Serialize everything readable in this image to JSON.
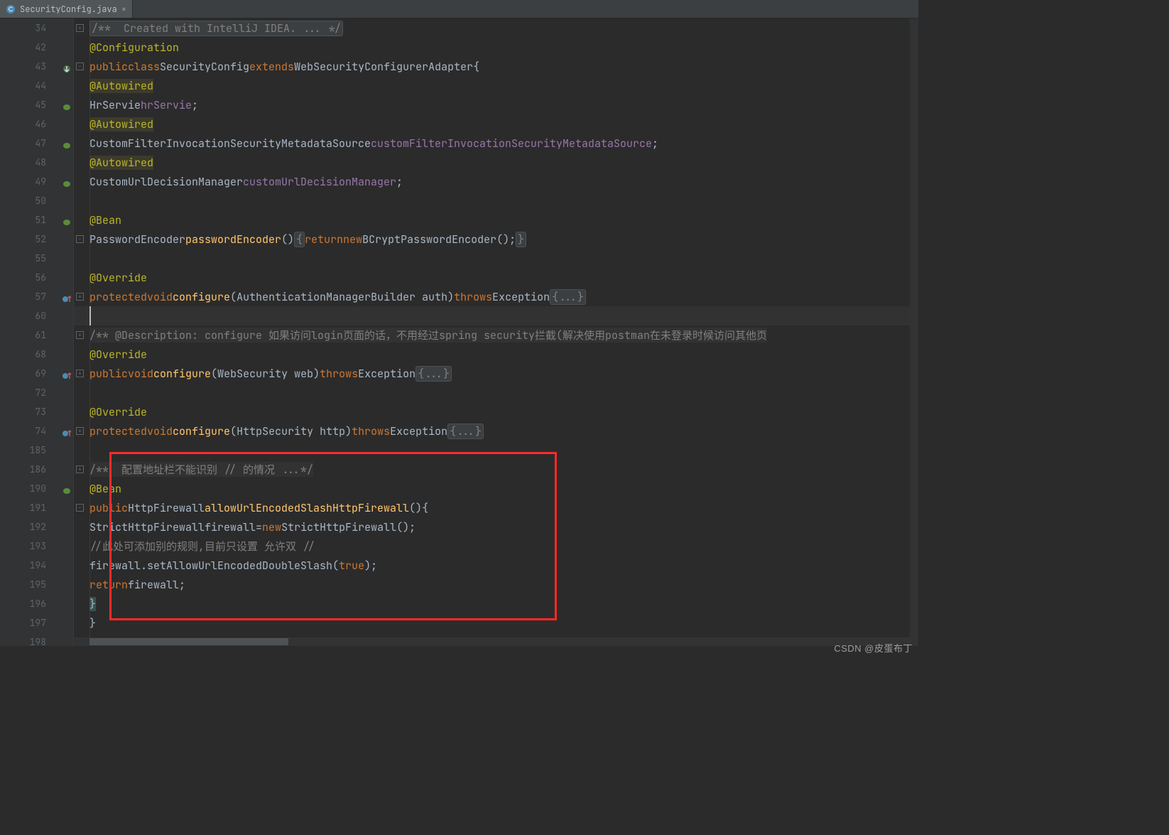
{
  "tab": {
    "filename": "SecurityConfig.java"
  },
  "watermark": "CSDN @皮蛋布丁",
  "gutter": {
    "line_numbers": [
      "34",
      "42",
      "43",
      "44",
      "45",
      "46",
      "47",
      "48",
      "49",
      "50",
      "51",
      "52",
      "55",
      "56",
      "57",
      "60",
      "61",
      "68",
      "69",
      "72",
      "73",
      "74",
      "185",
      "186",
      "190",
      "191",
      "192",
      "193",
      "194",
      "195",
      "196",
      "197",
      "198"
    ]
  },
  "code": {
    "l34": "/**  Created with IntelliJ IDEA. ... */",
    "l42": "@Configuration",
    "l43": {
      "kw1": "public",
      "kw2": "class",
      "name": "SecurityConfig",
      "kw3": "extends",
      "parent": "WebSecurityConfigurerAdapter",
      "brace": "{"
    },
    "l44": "@Autowired",
    "l45": {
      "type": "HrServie",
      "var": "hrServie",
      "semi": ";"
    },
    "l46": "@Autowired",
    "l47": {
      "type": "CustomFilterInvocationSecurityMetadataSource",
      "var": "customFilterInvocationSecurityMetadataSource",
      "semi": ";"
    },
    "l48": "@Autowired",
    "l49": {
      "type": "CustomUrlDecisionManager",
      "var": "customUrlDecisionManager",
      "semi": ";"
    },
    "l51": "@Bean",
    "l52": {
      "type": "PasswordEncoder",
      "name": "passwordEncoder",
      "rt": "return",
      "nw": "new",
      "cls": "BCryptPasswordEncoder"
    },
    "l56": "@Override",
    "l57": {
      "kw1": "protected",
      "kw2": "void",
      "name": "configure",
      "p": "AuthenticationManagerBuilder auth",
      "thr": "throws",
      "ex": "Exception"
    },
    "l61": "/** @Description: configure 如果访问login页面的话，不用经过spring security拦截(解决使用postman在未登录时候访问其他页",
    "l68": "@Override",
    "l69": {
      "kw1": "public",
      "kw2": "void",
      "name": "configure",
      "p": "WebSecurity web",
      "thr": "throws",
      "ex": "Exception"
    },
    "l73": "@Override",
    "l74": {
      "kw1": "protected",
      "kw2": "void",
      "name": "configure",
      "p": "HttpSecurity http",
      "thr": "throws",
      "ex": "Exception"
    },
    "l186": "/**  配置地址栏不能识别 // 的情况 ...*/",
    "l190": "@Bean",
    "l191": {
      "kw1": "public",
      "type": "HttpFirewall",
      "name": "allowUrlEncodedSlashHttpFirewall",
      "brace": "{"
    },
    "l192": {
      "type": "StrictHttpFirewall",
      "var": "firewall",
      "eq": "=",
      "nw": "new",
      "cls": "StrictHttpFirewall"
    },
    "l193": "//此处可添加别的规则,目前只设置 允许双 //",
    "l194": {
      "var": "firewall",
      "m": "setAllowUrlEncodedDoubleSlash",
      "arg": "true"
    },
    "l195": {
      "rt": "return",
      "var": "firewall"
    },
    "l196": "}",
    "l197": "}"
  }
}
